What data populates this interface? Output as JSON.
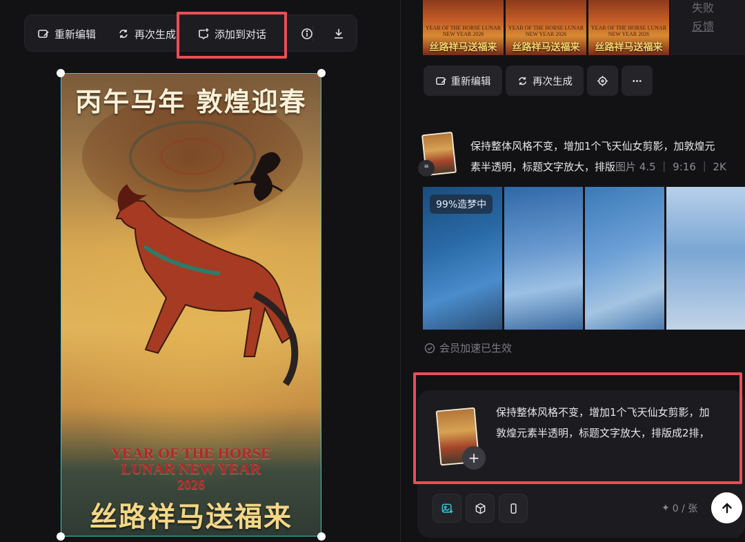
{
  "toolbar": {
    "reedit_label": "重新编辑",
    "regenerate_label": "再次生成",
    "add_to_chat_label": "添加到对话",
    "info_icon": "info-icon",
    "download_icon": "download-icon"
  },
  "poster": {
    "title": "丙午马年 敦煌迎春",
    "en_line1": "YEAR OF THE HORSE",
    "en_line2": "LUNAR NEW YEAR",
    "en_year": "2026",
    "bottom_title": "丝路祥马送福来"
  },
  "history": {
    "thumb_text": "丝路祥马送福来",
    "thumb_en": "YEAR OF THE HORSE LUNAR NEW YEAR 2026",
    "fail_text": "失败",
    "feedback_link": "反馈"
  },
  "result_actions": {
    "reedit_label": "重新编辑",
    "regenerate_label": "再次生成"
  },
  "prompt": {
    "line1": "保持整体风格不变，增加1个飞天仙女剪影，加敦煌元",
    "line2": "素半透明，标题文字放大，排版",
    "meta": "图片 4.5 ｜ 9:16 ｜ 2K"
  },
  "generation": {
    "progress_label": "99%造梦中",
    "progress_value": 99,
    "vip_text": "会员加速已生效"
  },
  "input": {
    "line1": "保持整体风格不变，增加1个飞天仙女剪影，加",
    "line2": "敦煌元素半透明，标题文字放大，排版成2排，",
    "plus_label": "+",
    "credits_text": "0 / 张"
  },
  "colors": {
    "highlight": "#ec4d55",
    "selection": "#3fc9c4",
    "accent": "#36c6d8"
  }
}
